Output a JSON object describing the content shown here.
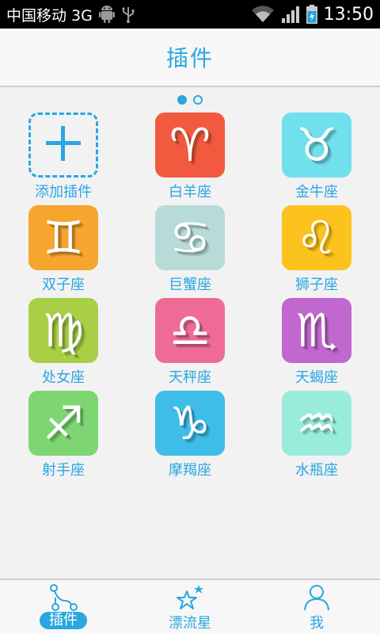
{
  "statusbar": {
    "carrier": "中国移动 3G",
    "time": "13:50"
  },
  "header": {
    "title": "插件"
  },
  "pager": {
    "count": 2,
    "active": 0
  },
  "plugins": [
    {
      "label": "添加插件",
      "icon": "plus-icon",
      "glyph": "+",
      "color": ""
    },
    {
      "label": "白羊座",
      "icon": "aries-icon",
      "glyph": "♈",
      "color": "#f15a3e"
    },
    {
      "label": "金牛座",
      "icon": "taurus-icon",
      "glyph": "♉",
      "color": "#6fe0ec"
    },
    {
      "label": "双子座",
      "icon": "gemini-icon",
      "glyph": "♊",
      "color": "#f6a52f"
    },
    {
      "label": "巨蟹座",
      "icon": "cancer-icon",
      "glyph": "♋",
      "color": "#b7dcd8"
    },
    {
      "label": "狮子座",
      "icon": "leo-icon",
      "glyph": "♌",
      "color": "#fcc21d"
    },
    {
      "label": "处女座",
      "icon": "virgo-icon",
      "glyph": "♍",
      "color": "#a8cf45"
    },
    {
      "label": "天秤座",
      "icon": "libra-icon",
      "glyph": "♎",
      "color": "#ee6b98"
    },
    {
      "label": "天蝎座",
      "icon": "scorpio-icon",
      "glyph": "♏",
      "color": "#c167d0"
    },
    {
      "label": "射手座",
      "icon": "sagittarius-icon",
      "glyph": "♐",
      "color": "#7ed672"
    },
    {
      "label": "摩羯座",
      "icon": "capricorn-icon",
      "glyph": "♑",
      "color": "#3ebde9"
    },
    {
      "label": "水瓶座",
      "icon": "aquarius-icon",
      "glyph": "♒",
      "color": "#99ecdc"
    }
  ],
  "nav": [
    {
      "label": "插件",
      "icon": "share-nodes-icon",
      "active": true
    },
    {
      "label": "漂流星",
      "icon": "stars-icon",
      "active": false
    },
    {
      "label": "我",
      "icon": "user-icon",
      "active": false
    }
  ],
  "colors": {
    "accent": "#29a7e1"
  }
}
